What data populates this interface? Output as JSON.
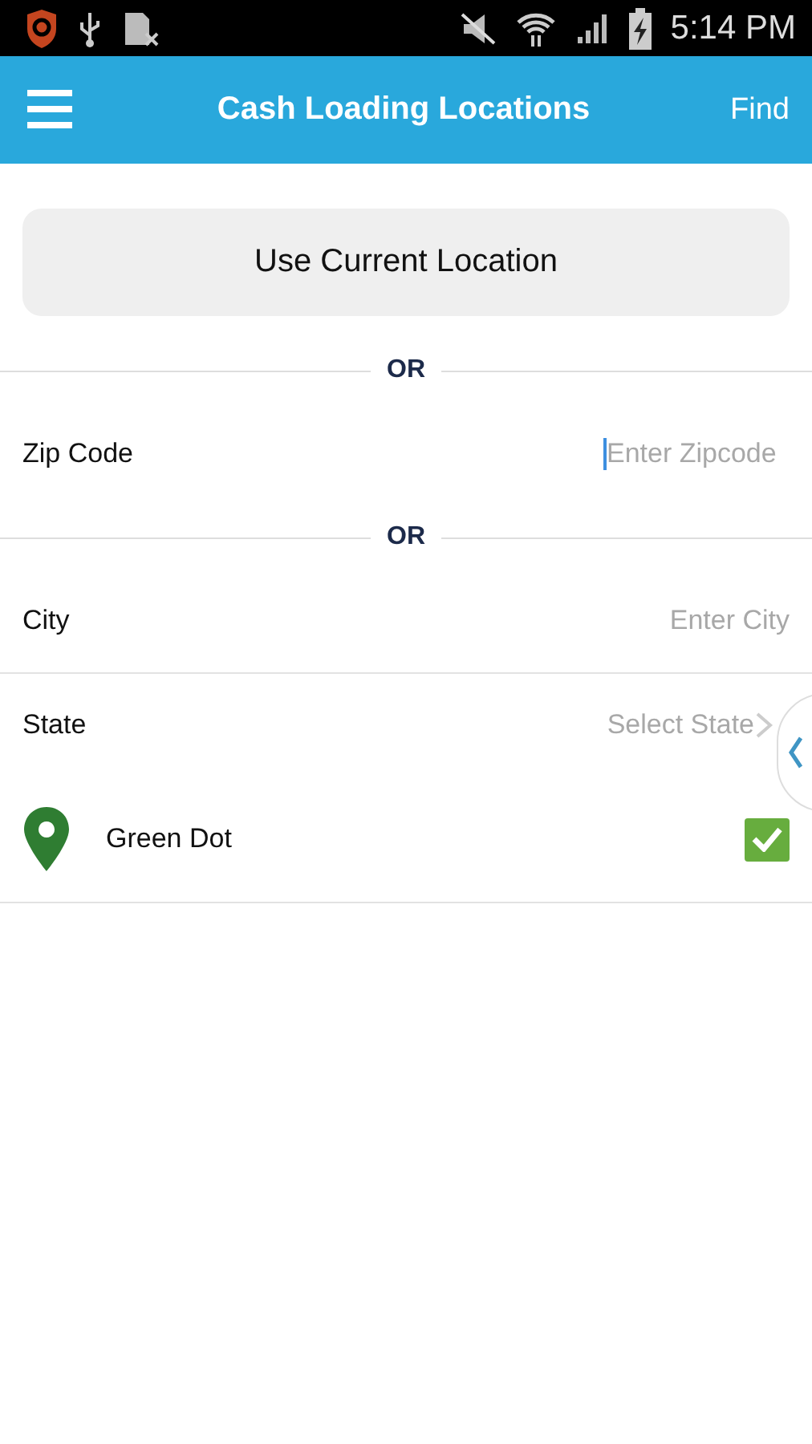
{
  "status_bar": {
    "time": "5:14 PM"
  },
  "app_bar": {
    "title": "Cash Loading Locations",
    "action": "Find"
  },
  "current_location_button": "Use Current Location",
  "form": [
    {
      "kind": "divider",
      "label": "OR"
    },
    {
      "kind": "text",
      "label": "Zip Code",
      "placeholder": "Enter Zipcode",
      "focused": true
    },
    {
      "kind": "divider",
      "label": "OR"
    },
    {
      "kind": "text",
      "label": "City",
      "placeholder": "Enter City",
      "focused": false
    },
    {
      "kind": "select",
      "label": "State",
      "placeholder": "Select State"
    },
    {
      "kind": "check",
      "label": "Green Dot",
      "checked": true
    }
  ]
}
